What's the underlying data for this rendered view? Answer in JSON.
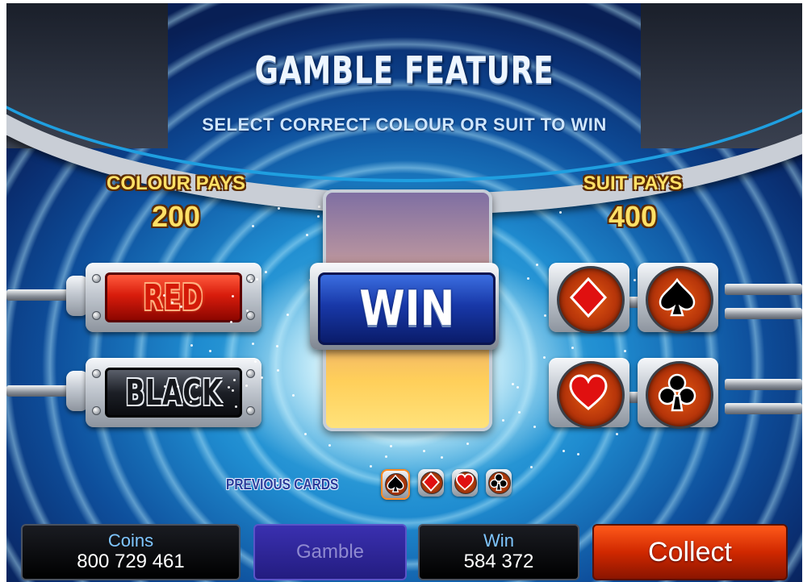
{
  "game": {
    "title": "GAMBLE FEATURE",
    "subtitle": "SELECT CORRECT COLOUR OR SUIT TO WIN"
  },
  "colour_pays": {
    "label": "COLOUR PAYS",
    "value": "200"
  },
  "suit_pays": {
    "label": "SUIT PAYS",
    "value": "400"
  },
  "colour_buttons": {
    "red": "RED",
    "black": "BLACK"
  },
  "suit_buttons": [
    {
      "suit": "diamond",
      "icon": "diamond-icon",
      "color": "#e01010"
    },
    {
      "suit": "spade",
      "icon": "spade-icon",
      "color": "#000000"
    },
    {
      "suit": "heart",
      "icon": "heart-icon",
      "color": "#e01010"
    },
    {
      "suit": "club",
      "icon": "club-icon",
      "color": "#000000"
    }
  ],
  "result_badge": "WIN",
  "previous_cards": {
    "label": "PREVIOUS CARDS",
    "cards": [
      "spade",
      "diamond",
      "heart",
      "club"
    ]
  },
  "bottom_bar": {
    "coins_label": "Coins",
    "coins_value": "800 729 461",
    "gamble_label": "Gamble",
    "win_label": "Win",
    "win_value": "584 372",
    "collect_label": "Collect"
  },
  "colors": {
    "accent_gold": "#ffe066",
    "collect_red": "#d02800",
    "gamble_purple": "#2a22a0",
    "win_blue": "#1838a8"
  }
}
